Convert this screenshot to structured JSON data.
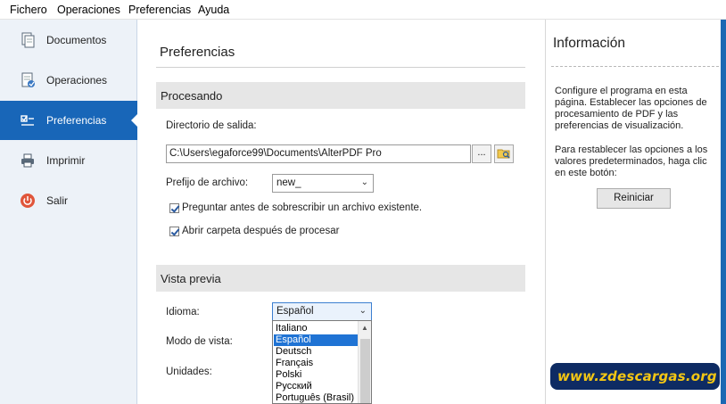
{
  "menu": [
    "Fichero",
    "Operaciones",
    "Preferencias",
    "Ayuda"
  ],
  "sidebar": {
    "items": [
      {
        "label": "Documentos",
        "icon": "documents-icon"
      },
      {
        "label": "Operaciones",
        "icon": "operations-icon"
      },
      {
        "label": "Preferencias",
        "icon": "preferences-icon",
        "active": true
      },
      {
        "label": "Imprimir",
        "icon": "printer-icon"
      },
      {
        "label": "Salir",
        "icon": "power-icon"
      }
    ],
    "active_color": "#1866b8"
  },
  "main": {
    "title": "Preferencias",
    "processing": {
      "header": "Procesando",
      "output_dir_label": "Directorio de salida:",
      "output_dir_value": "C:\\Users\\egaforce99\\Documents\\AlterPDF Pro",
      "browse_label": "...",
      "prefix_label": "Prefijo de archivo:",
      "prefix_value": "new_",
      "ask_overwrite_label": "Preguntar antes de sobrescribir un archivo existente.",
      "open_folder_label": "Abrir carpeta después de procesar"
    },
    "preview": {
      "header": "Vista previa",
      "language_label": "Idioma:",
      "language_value": "Español",
      "view_mode_label": "Modo de vista:",
      "units_label": "Unidades:",
      "language_options": [
        "Italiano",
        "Español",
        "Deutsch",
        "Français",
        "Polski",
        "Русский",
        "Português (Brasil)"
      ],
      "selected_option": "Español"
    }
  },
  "info": {
    "title": "Información",
    "text1": "Configure el programa en esta página. Establecer las opciones de procesamiento de PDF y las preferencias de visualización.",
    "text2": "Para restablecer las opciones a los valores predeterminados, haga clic en este botón:",
    "reset_label": "Reiniciar"
  },
  "watermark": "www.zdescargas.org"
}
